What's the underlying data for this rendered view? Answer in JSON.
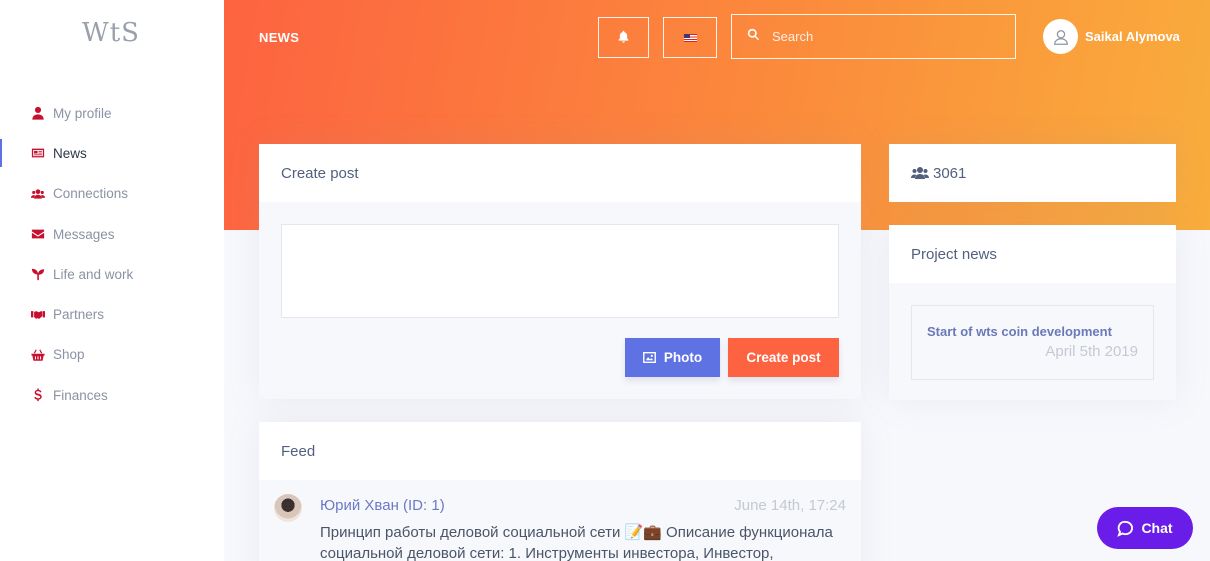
{
  "app": {
    "logo": "WtS"
  },
  "header": {
    "title": "NEWS",
    "search_placeholder": "Search",
    "user_name": "Saikal Alymova"
  },
  "sidebar": {
    "items": [
      {
        "label": "My profile",
        "icon": "user-icon"
      },
      {
        "label": "News",
        "icon": "newspaper-icon",
        "active": true
      },
      {
        "label": "Connections",
        "icon": "users-icon"
      },
      {
        "label": "Messages",
        "icon": "envelope-icon"
      },
      {
        "label": "Life and work",
        "icon": "seedling-icon"
      },
      {
        "label": "Partners",
        "icon": "handshake-icon"
      },
      {
        "label": "Shop",
        "icon": "basket-icon"
      },
      {
        "label": "Finances",
        "icon": "dollar-icon"
      }
    ]
  },
  "create_post": {
    "title": "Create post",
    "photo_label": "Photo",
    "submit_label": "Create post"
  },
  "members": {
    "count": "3061"
  },
  "project_news": {
    "title": "Project news",
    "items": [
      {
        "title": "Start of wts coin development",
        "date": "April 5th 2019"
      }
    ]
  },
  "feed": {
    "title": "Feed",
    "items": [
      {
        "author": "Юрий Хван (ID: 1)",
        "time": "June 14th, 17:24",
        "text": "Принцип работы деловой социальной сети 📝💼 Описание функционала социальной деловой сети: 1. Инструменты инвестора, Инвестор,"
      }
    ]
  },
  "chat": {
    "label": "Chat"
  },
  "colors": {
    "accent": "#5e72e4",
    "brand": "#fd6340",
    "icon_red": "#c8102e",
    "chat": "#6a1de8"
  }
}
